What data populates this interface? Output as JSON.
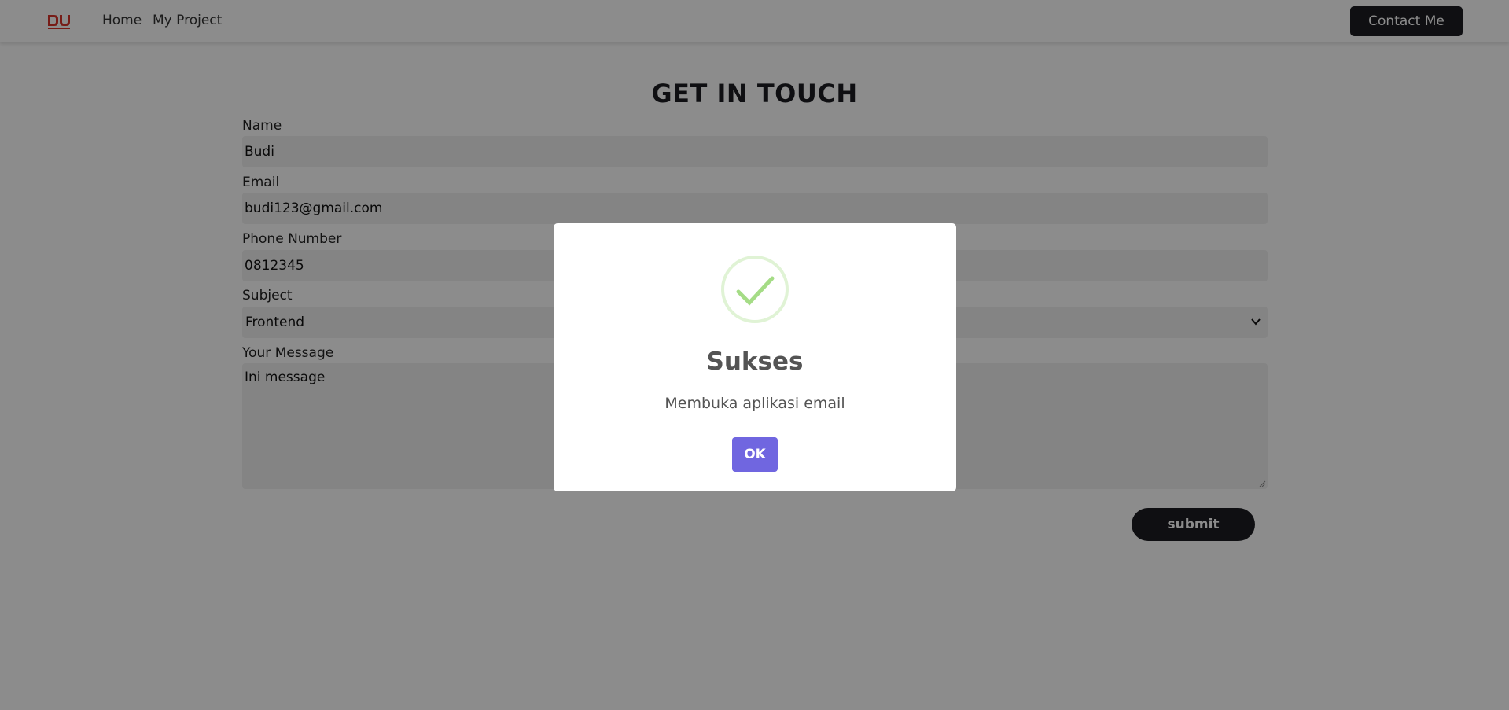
{
  "navbar": {
    "logo_text": "DU",
    "links": [
      {
        "label": "Home"
      },
      {
        "label": "My Project"
      }
    ],
    "contact_label": "Contact Me"
  },
  "form": {
    "title": "GET IN TOUCH",
    "name_label": "Name",
    "name_value": "Budi",
    "email_label": "Email",
    "email_value": "budi123@gmail.com",
    "phone_label": "Phone Number",
    "phone_value": "0812345",
    "subject_label": "Subject",
    "subject_value": "Frontend",
    "message_label": "Your Message",
    "message_value": "Ini message",
    "submit_label": "submit"
  },
  "modal": {
    "title": "Sukses",
    "text": "Membuka aplikasi email",
    "ok_label": "OK"
  },
  "colors": {
    "accent_dark": "#1c1d22",
    "logo_red": "#d9342b",
    "success_green": "#a5dc86",
    "confirm_purple": "#7066e0",
    "overlay": "rgba(0,0,0,0.45)"
  },
  "icons": {
    "logo": "du-logo",
    "success": "success-check-icon",
    "select": "chevron-down-icon"
  }
}
